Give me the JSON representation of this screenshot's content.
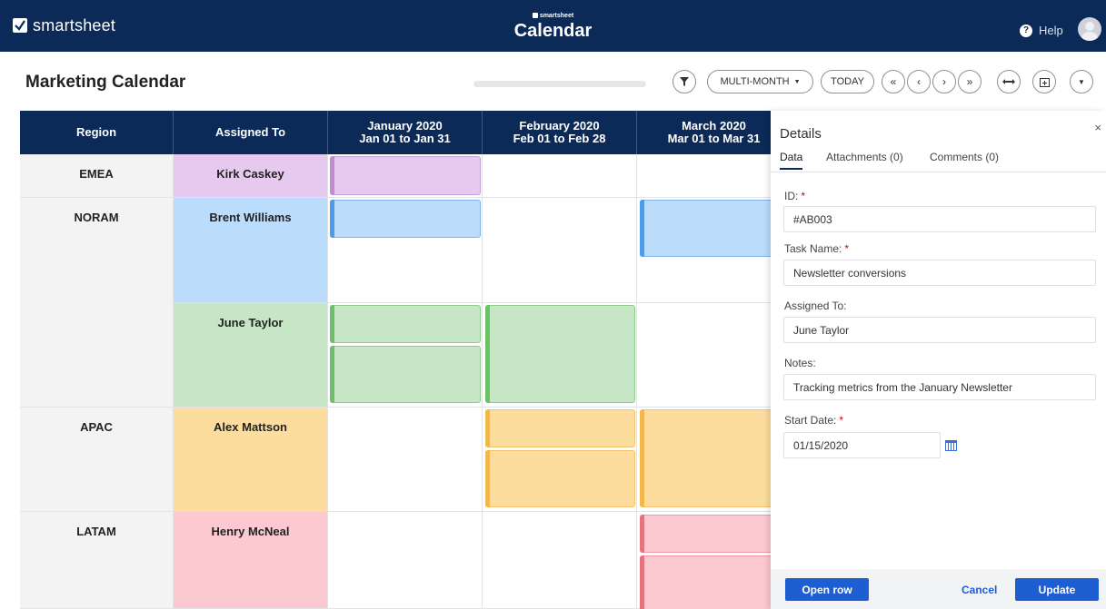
{
  "app": {
    "brand": "smartsheet",
    "small_brand": "smartsheet",
    "title": "Calendar",
    "help_label": "Help"
  },
  "toolbar": {
    "page_title": "Marketing Calendar",
    "view_label": "MULTI-MONTH",
    "today_label": "TODAY",
    "first_label": "«",
    "prev_label": "‹",
    "next_label": "›",
    "last_label": "»",
    "icons": [
      "filter-icon",
      "caret-down-icon",
      "first-page-icon",
      "prev-icon",
      "next-icon",
      "last-page-icon",
      "fit-width-icon",
      "calendar-add-icon",
      "more-icon"
    ]
  },
  "calendar": {
    "columns": [
      {
        "line1": "Region",
        "line2": ""
      },
      {
        "line1": "Assigned To",
        "line2": ""
      },
      {
        "line1": "January 2020",
        "line2": "Jan 01 to Jan 31"
      },
      {
        "line1": "February 2020",
        "line2": "Feb 01 to Feb 28"
      },
      {
        "line1": "March 2020",
        "line2": "Mar 01 to Mar 31"
      }
    ],
    "rows": [
      {
        "region": "EMEA",
        "assigned": "Kirk Caskey",
        "color": "#e7c8ee",
        "border": "#c6a3d6",
        "accent": "#c08ad4"
      },
      {
        "region": "NORAM",
        "assigned": "Brent Williams",
        "color": "#bcdcfb",
        "border": "#7fb4ec",
        "accent": "#4e9be8"
      },
      {
        "region": "",
        "assigned": "June Taylor",
        "color": "#c7e6c5",
        "border": "#8fcb8b",
        "accent": "#6dc068"
      },
      {
        "region": "APAC",
        "assigned": "Alex Mattson",
        "color": "#fcdd9d",
        "border": "#f1c36a",
        "accent": "#f2b84e"
      },
      {
        "region": "LATAM",
        "assigned": "Henry McNeal",
        "color": "#fbc9cf",
        "border": "#ef9aa4",
        "accent": "#e9727f"
      }
    ]
  },
  "details": {
    "title": "Details",
    "close_label": "×",
    "tabs": [
      "Data",
      "Attachments (0)",
      "Comments (0)"
    ],
    "fields": {
      "id_label": "ID:",
      "id_value": "#AB003",
      "task_label": "Task Name:",
      "task_value": "Newsletter conversions",
      "assigned_label": "Assigned To:",
      "assigned_value": "June Taylor",
      "notes_label": "Notes:",
      "notes_value": "Tracking metrics from the January Newsletter",
      "start_label": "Start Date:",
      "start_value": "01/15/2020"
    },
    "required_mark": "*",
    "buttons": {
      "open_row": "Open row",
      "cancel": "Cancel",
      "update": "Update"
    }
  }
}
